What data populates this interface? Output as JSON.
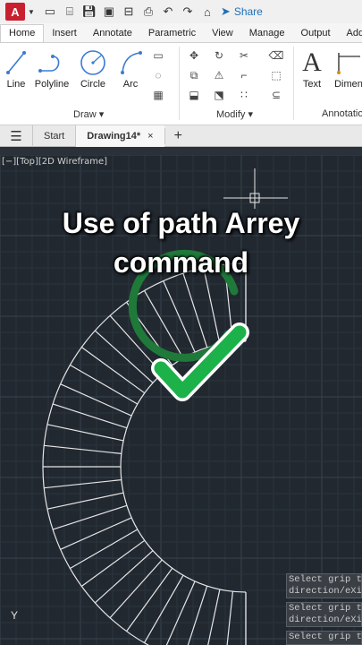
{
  "app": {
    "logo_letter": "A",
    "share_label": "Share"
  },
  "ribbon": {
    "tabs": [
      "Home",
      "Insert",
      "Annotate",
      "Parametric",
      "View",
      "Manage",
      "Output",
      "Add"
    ],
    "active_tab": "Home",
    "draw_tools": [
      "Line",
      "Polyline",
      "Circle",
      "Arc"
    ],
    "draw_panel_label": "Draw ▾",
    "modify_panel_label": "Modify ▾",
    "text_tool": "Text",
    "dim_tool": "Dimen",
    "annotation_panel_label": "Annotatio"
  },
  "file_tabs": {
    "start": "Start",
    "drawing": "Drawing14*",
    "close_glyph": "×",
    "add_glyph": "+"
  },
  "viewport": {
    "label": "[−][Top][2D Wireframe]"
  },
  "overlay": {
    "line1": "Use of path Arrey",
    "line2": "command"
  },
  "command_history": [
    {
      "line1": "Select grip t",
      "line2": "direction/eXi"
    },
    {
      "line1": "Select grip t",
      "line2": "direction/eXi"
    },
    {
      "line1": "Select grip t",
      "line2": ""
    }
  ],
  "ucs": {
    "y_label": "Y"
  },
  "colors": {
    "check": "#1db14a",
    "check_ring": "#1f7a3a",
    "canvas": "#212830",
    "app_red": "#c8202f"
  },
  "icons": [
    "new-icon",
    "open-icon",
    "save-icon",
    "saveas-icon",
    "print-icon",
    "undo-icon",
    "redo-icon",
    "share-icon"
  ]
}
